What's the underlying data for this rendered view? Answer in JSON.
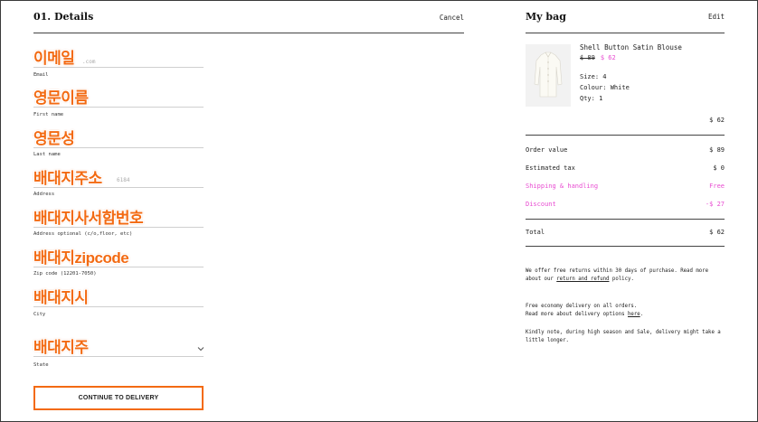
{
  "details": {
    "title": "01. Details",
    "cancel": "Cancel",
    "fields": [
      {
        "label": "Email",
        "value": "이메일",
        "ghost": ".com"
      },
      {
        "label": "First name",
        "value": "영문이름",
        "ghost": ""
      },
      {
        "label": "Last name",
        "value": "영문성",
        "ghost": ""
      },
      {
        "label": "Address",
        "value": "배대지주소",
        "ghost": "6184"
      },
      {
        "label": "Address optional (c/o,floor, etc)",
        "value": "배대지사서함번호",
        "ghost": ""
      },
      {
        "label": "Zip code (12201-7050)",
        "value": "배대지zipcode",
        "ghost": ""
      },
      {
        "label": "City",
        "value": "배대지시",
        "ghost": ""
      },
      {
        "label": "State",
        "value": "배대지주",
        "ghost": ""
      }
    ],
    "cta": "CONTINUE TO DELIVERY"
  },
  "bag": {
    "title": "My bag",
    "edit": "Edit",
    "product": {
      "name": "Shell Button Satin Blouse",
      "old_price": "$ 89",
      "new_price": "$ 62",
      "size": "Size:  4",
      "colour": "Colour:  White",
      "qty": "Qty:  1"
    },
    "subtotal": "$ 62",
    "summary": [
      {
        "label": "Order value",
        "value": "$ 89"
      },
      {
        "label": "Estimated tax",
        "value": "$ 0"
      },
      {
        "label": "Shipping & handling",
        "value": "Free"
      },
      {
        "label": "Discount",
        "value": "-$ 27"
      }
    ],
    "total_label": "Total",
    "total_value": "$ 62",
    "returns_note_a": "We offer free returns within 30 days of purchase. Read more about our ",
    "returns_link": "return and refund",
    "returns_note_b": " policy.",
    "delivery_note_a": "Free economy delivery on all orders.",
    "delivery_note_b": "Read more about delivery options ",
    "delivery_link": "here",
    "delivery_note_c": ".",
    "season_note": "Kindly note, during high season and Sale, delivery might take a little longer."
  },
  "colors": {
    "accent": "#f36a12",
    "discount": "#e84bd1"
  }
}
